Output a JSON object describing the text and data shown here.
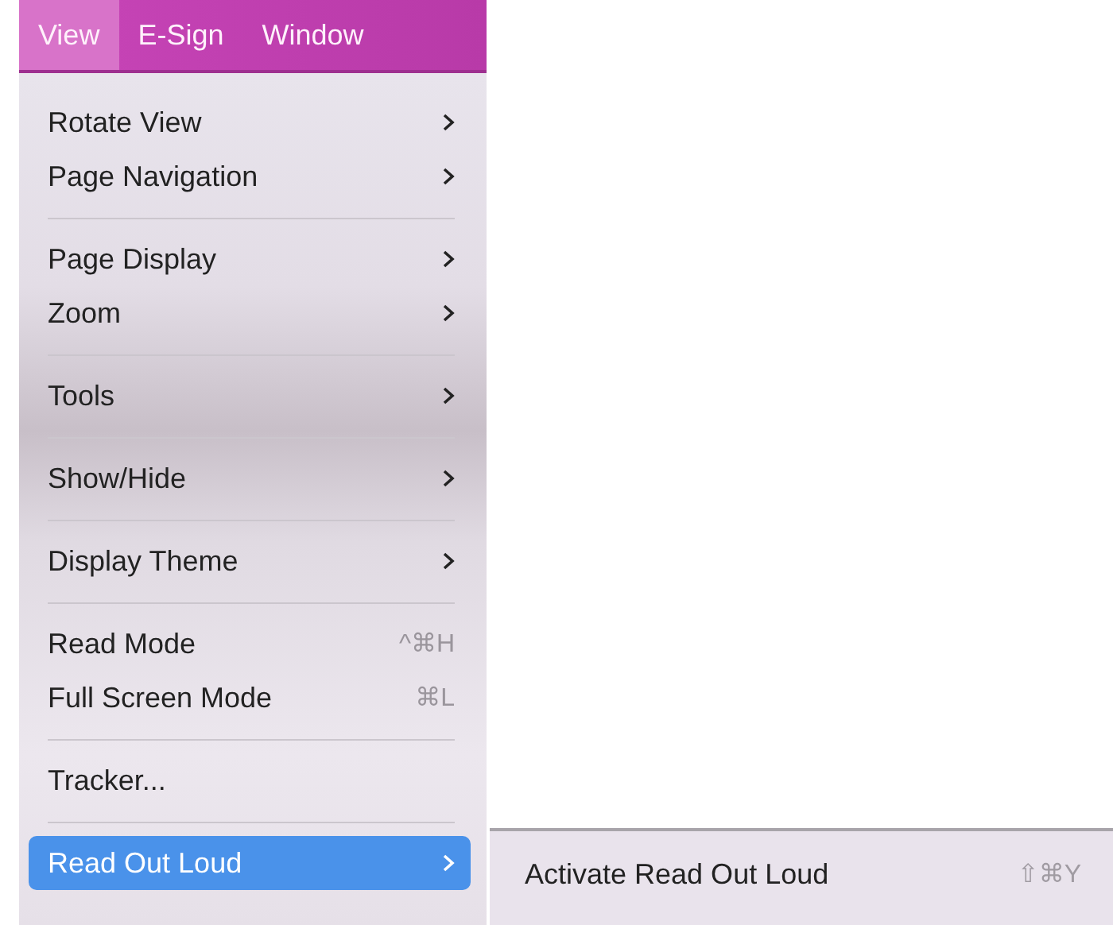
{
  "menubar": [
    {
      "label": "View",
      "selected": true
    },
    {
      "label": "E-Sign",
      "selected": false
    },
    {
      "label": "Window",
      "selected": false
    }
  ],
  "menu": {
    "groups": [
      {
        "items": [
          {
            "label": "Rotate View",
            "kind": "submenu",
            "selected": false,
            "disabled": false
          },
          {
            "label": "Page Navigation",
            "kind": "submenu",
            "selected": false,
            "disabled": false
          }
        ]
      },
      {
        "items": [
          {
            "label": "Page Display",
            "kind": "submenu",
            "selected": false,
            "disabled": false
          },
          {
            "label": "Zoom",
            "kind": "submenu",
            "selected": false,
            "disabled": false
          }
        ]
      },
      {
        "items": [
          {
            "label": "Tools",
            "kind": "submenu",
            "selected": false,
            "disabled": false
          }
        ]
      },
      {
        "items": [
          {
            "label": "Show/Hide",
            "kind": "submenu",
            "selected": false,
            "disabled": false
          }
        ]
      },
      {
        "items": [
          {
            "label": "Display Theme",
            "kind": "submenu",
            "selected": false,
            "disabled": false
          }
        ]
      },
      {
        "items": [
          {
            "label": "Read Mode",
            "kind": "shortcut",
            "shortcut": "^⌘H",
            "selected": false,
            "disabled": false
          },
          {
            "label": "Full Screen Mode",
            "kind": "shortcut",
            "shortcut": "⌘L",
            "selected": false,
            "disabled": false
          }
        ]
      },
      {
        "items": [
          {
            "label": "Tracker...",
            "kind": "plain",
            "selected": false,
            "disabled": false
          }
        ]
      },
      {
        "items": [
          {
            "label": "Read Out Loud",
            "kind": "submenu",
            "selected": true,
            "disabled": false
          }
        ]
      }
    ]
  },
  "submenu": {
    "items": [
      {
        "label": "Activate Read Out Loud",
        "shortcut": "⇧⌘Y",
        "disabled": false
      }
    ]
  }
}
